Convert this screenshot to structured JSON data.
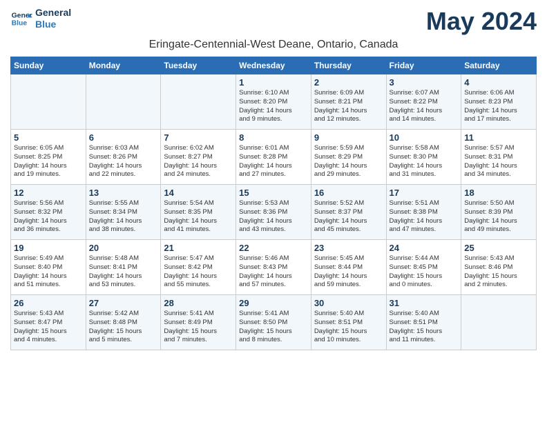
{
  "header": {
    "logo_line1": "General",
    "logo_line2": "Blue",
    "month_title": "May 2024",
    "location": "Eringate-Centennial-West Deane, Ontario, Canada"
  },
  "weekdays": [
    "Sunday",
    "Monday",
    "Tuesday",
    "Wednesday",
    "Thursday",
    "Friday",
    "Saturday"
  ],
  "weeks": [
    [
      {
        "day": "",
        "detail": ""
      },
      {
        "day": "",
        "detail": ""
      },
      {
        "day": "",
        "detail": ""
      },
      {
        "day": "1",
        "detail": "Sunrise: 6:10 AM\nSunset: 8:20 PM\nDaylight: 14 hours\nand 9 minutes."
      },
      {
        "day": "2",
        "detail": "Sunrise: 6:09 AM\nSunset: 8:21 PM\nDaylight: 14 hours\nand 12 minutes."
      },
      {
        "day": "3",
        "detail": "Sunrise: 6:07 AM\nSunset: 8:22 PM\nDaylight: 14 hours\nand 14 minutes."
      },
      {
        "day": "4",
        "detail": "Sunrise: 6:06 AM\nSunset: 8:23 PM\nDaylight: 14 hours\nand 17 minutes."
      }
    ],
    [
      {
        "day": "5",
        "detail": "Sunrise: 6:05 AM\nSunset: 8:25 PM\nDaylight: 14 hours\nand 19 minutes."
      },
      {
        "day": "6",
        "detail": "Sunrise: 6:03 AM\nSunset: 8:26 PM\nDaylight: 14 hours\nand 22 minutes."
      },
      {
        "day": "7",
        "detail": "Sunrise: 6:02 AM\nSunset: 8:27 PM\nDaylight: 14 hours\nand 24 minutes."
      },
      {
        "day": "8",
        "detail": "Sunrise: 6:01 AM\nSunset: 8:28 PM\nDaylight: 14 hours\nand 27 minutes."
      },
      {
        "day": "9",
        "detail": "Sunrise: 5:59 AM\nSunset: 8:29 PM\nDaylight: 14 hours\nand 29 minutes."
      },
      {
        "day": "10",
        "detail": "Sunrise: 5:58 AM\nSunset: 8:30 PM\nDaylight: 14 hours\nand 31 minutes."
      },
      {
        "day": "11",
        "detail": "Sunrise: 5:57 AM\nSunset: 8:31 PM\nDaylight: 14 hours\nand 34 minutes."
      }
    ],
    [
      {
        "day": "12",
        "detail": "Sunrise: 5:56 AM\nSunset: 8:32 PM\nDaylight: 14 hours\nand 36 minutes."
      },
      {
        "day": "13",
        "detail": "Sunrise: 5:55 AM\nSunset: 8:34 PM\nDaylight: 14 hours\nand 38 minutes."
      },
      {
        "day": "14",
        "detail": "Sunrise: 5:54 AM\nSunset: 8:35 PM\nDaylight: 14 hours\nand 41 minutes."
      },
      {
        "day": "15",
        "detail": "Sunrise: 5:53 AM\nSunset: 8:36 PM\nDaylight: 14 hours\nand 43 minutes."
      },
      {
        "day": "16",
        "detail": "Sunrise: 5:52 AM\nSunset: 8:37 PM\nDaylight: 14 hours\nand 45 minutes."
      },
      {
        "day": "17",
        "detail": "Sunrise: 5:51 AM\nSunset: 8:38 PM\nDaylight: 14 hours\nand 47 minutes."
      },
      {
        "day": "18",
        "detail": "Sunrise: 5:50 AM\nSunset: 8:39 PM\nDaylight: 14 hours\nand 49 minutes."
      }
    ],
    [
      {
        "day": "19",
        "detail": "Sunrise: 5:49 AM\nSunset: 8:40 PM\nDaylight: 14 hours\nand 51 minutes."
      },
      {
        "day": "20",
        "detail": "Sunrise: 5:48 AM\nSunset: 8:41 PM\nDaylight: 14 hours\nand 53 minutes."
      },
      {
        "day": "21",
        "detail": "Sunrise: 5:47 AM\nSunset: 8:42 PM\nDaylight: 14 hours\nand 55 minutes."
      },
      {
        "day": "22",
        "detail": "Sunrise: 5:46 AM\nSunset: 8:43 PM\nDaylight: 14 hours\nand 57 minutes."
      },
      {
        "day": "23",
        "detail": "Sunrise: 5:45 AM\nSunset: 8:44 PM\nDaylight: 14 hours\nand 59 minutes."
      },
      {
        "day": "24",
        "detail": "Sunrise: 5:44 AM\nSunset: 8:45 PM\nDaylight: 15 hours\nand 0 minutes."
      },
      {
        "day": "25",
        "detail": "Sunrise: 5:43 AM\nSunset: 8:46 PM\nDaylight: 15 hours\nand 2 minutes."
      }
    ],
    [
      {
        "day": "26",
        "detail": "Sunrise: 5:43 AM\nSunset: 8:47 PM\nDaylight: 15 hours\nand 4 minutes."
      },
      {
        "day": "27",
        "detail": "Sunrise: 5:42 AM\nSunset: 8:48 PM\nDaylight: 15 hours\nand 5 minutes."
      },
      {
        "day": "28",
        "detail": "Sunrise: 5:41 AM\nSunset: 8:49 PM\nDaylight: 15 hours\nand 7 minutes."
      },
      {
        "day": "29",
        "detail": "Sunrise: 5:41 AM\nSunset: 8:50 PM\nDaylight: 15 hours\nand 8 minutes."
      },
      {
        "day": "30",
        "detail": "Sunrise: 5:40 AM\nSunset: 8:51 PM\nDaylight: 15 hours\nand 10 minutes."
      },
      {
        "day": "31",
        "detail": "Sunrise: 5:40 AM\nSunset: 8:51 PM\nDaylight: 15 hours\nand 11 minutes."
      },
      {
        "day": "",
        "detail": ""
      }
    ]
  ]
}
